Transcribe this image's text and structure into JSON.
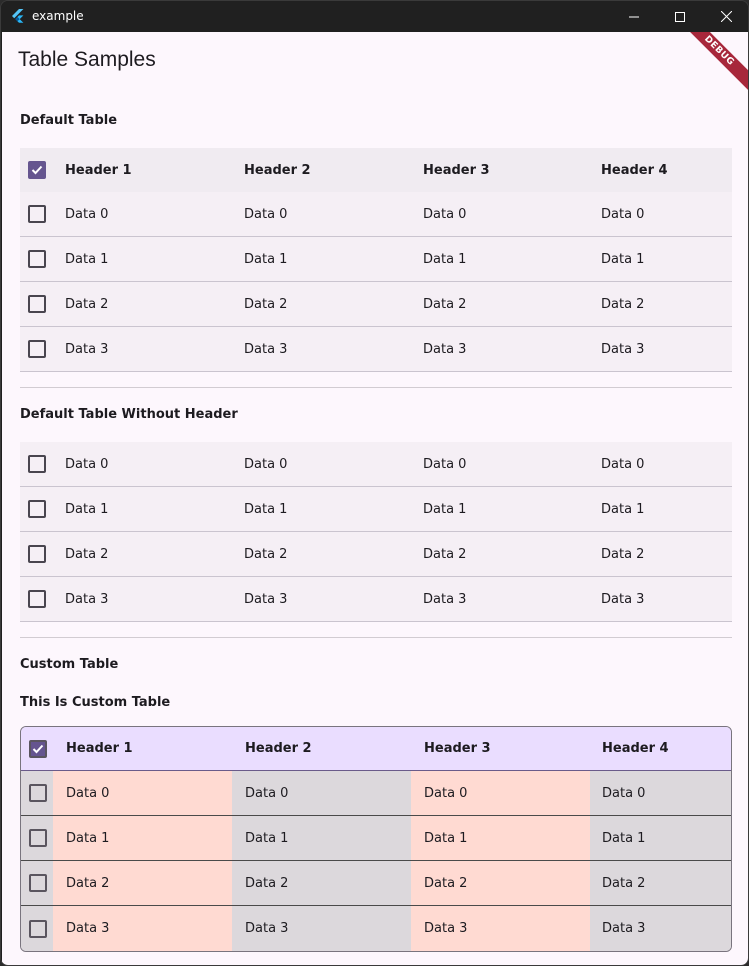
{
  "window": {
    "title": "example"
  },
  "page": {
    "title": "Table Samples",
    "debug_label": "DEBUG"
  },
  "default_table": {
    "section_title": "Default Table",
    "headers": [
      "Header 1",
      "Header 2",
      "Header 3",
      "Header 4"
    ],
    "header_checked": true,
    "rows": [
      [
        "Data 0",
        "Data 0",
        "Data 0",
        "Data 0"
      ],
      [
        "Data 1",
        "Data 1",
        "Data 1",
        "Data 1"
      ],
      [
        "Data 2",
        "Data 2",
        "Data 2",
        "Data 2"
      ],
      [
        "Data 3",
        "Data 3",
        "Data 3",
        "Data 3"
      ]
    ]
  },
  "no_header_table": {
    "section_title": "Default Table Without Header",
    "rows": [
      [
        "Data 0",
        "Data 0",
        "Data 0",
        "Data 0"
      ],
      [
        "Data 1",
        "Data 1",
        "Data 1",
        "Data 1"
      ],
      [
        "Data 2",
        "Data 2",
        "Data 2",
        "Data 2"
      ],
      [
        "Data 3",
        "Data 3",
        "Data 3",
        "Data 3"
      ]
    ]
  },
  "custom_table": {
    "section_title": "Custom Table",
    "caption": "This Is Custom Table",
    "headers": [
      "Header 1",
      "Header 2",
      "Header 3",
      "Header 4"
    ],
    "header_checked": true,
    "header_color": "#eaddff",
    "column_colors": [
      "#ffdad2",
      "#dcd8dc"
    ],
    "rows": [
      [
        "Data 0",
        "Data 0",
        "Data 0",
        "Data 0"
      ],
      [
        "Data 1",
        "Data 1",
        "Data 1",
        "Data 1"
      ],
      [
        "Data 2",
        "Data 2",
        "Data 2",
        "Data 2"
      ],
      [
        "Data 3",
        "Data 3",
        "Data 3",
        "Data 3"
      ]
    ]
  },
  "colors": {
    "accent": "#65558f",
    "background": "#fdf7fd",
    "debug_banner": "#a7273b"
  }
}
